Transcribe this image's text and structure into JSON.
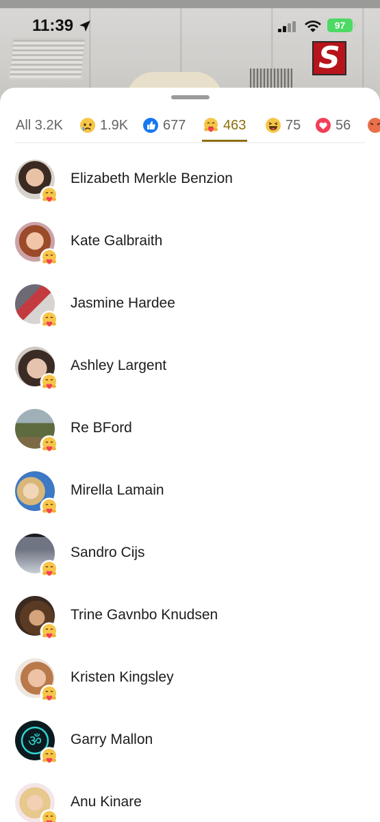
{
  "status_bar": {
    "time": "11:39",
    "battery": "97"
  },
  "header_logo": "S",
  "tabs": [
    {
      "label": "All 3.2K",
      "icon": "none",
      "active": false
    },
    {
      "label": "1.9K",
      "icon": "sad-face-icon",
      "active": false
    },
    {
      "label": "677",
      "icon": "like-icon",
      "active": false
    },
    {
      "label": "463",
      "icon": "care-icon",
      "active": true
    },
    {
      "label": "75",
      "icon": "haha-icon",
      "active": false
    },
    {
      "label": "56",
      "icon": "love-icon",
      "active": false
    }
  ],
  "people": [
    {
      "name": "Elizabeth Merkle Benzion"
    },
    {
      "name": "Kate Galbraith"
    },
    {
      "name": "Jasmine Hardee"
    },
    {
      "name": "Ashley Largent"
    },
    {
      "name": "Re BFord"
    },
    {
      "name": "Mirella Lamain"
    },
    {
      "name": "Sandro Cijs"
    },
    {
      "name": "Trine Gavnbo Knudsen"
    },
    {
      "name": "Kristen Kingsley"
    },
    {
      "name": "Garry Mallon"
    },
    {
      "name": "Anu Kinare"
    }
  ],
  "colors": {
    "accent": "#8a6d0a",
    "battery": "#4cd964",
    "like": "#1877f2",
    "love": "#f33e58"
  }
}
